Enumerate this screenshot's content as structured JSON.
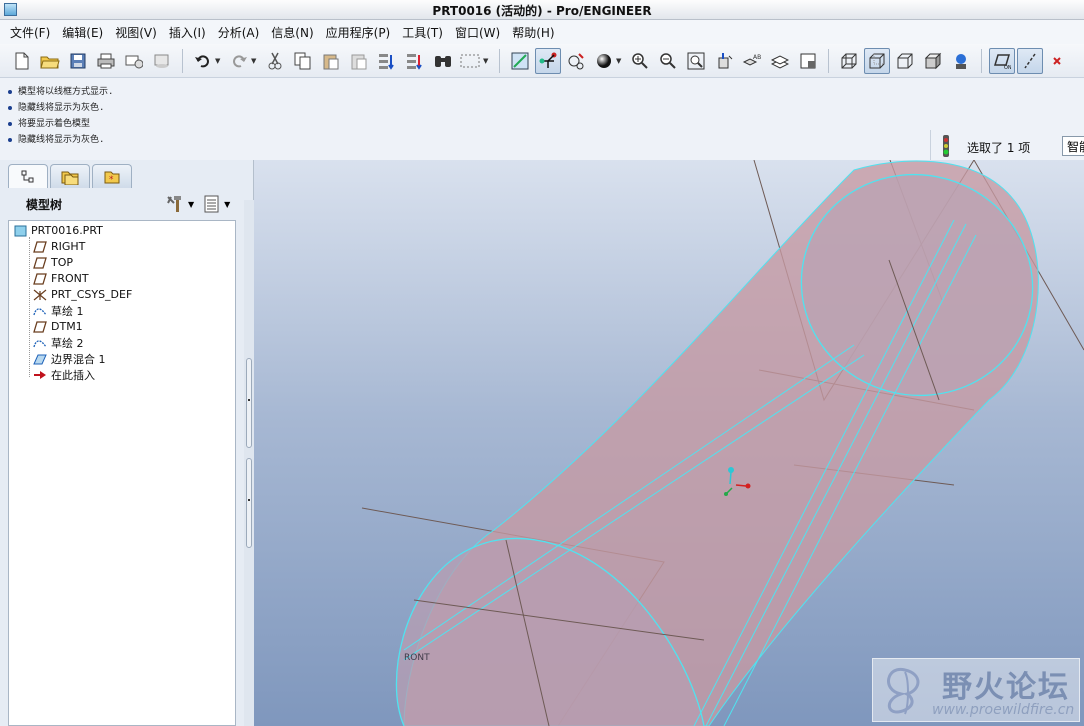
{
  "window": {
    "title": "PRT0016 (活动的) - Pro/ENGINEER"
  },
  "menu": [
    "文件(F)",
    "编辑(E)",
    "视图(V)",
    "插入(I)",
    "分析(A)",
    "信息(N)",
    "应用程序(P)",
    "工具(T)",
    "窗口(W)",
    "帮助(H)"
  ],
  "toolbar": {
    "groups": [
      [
        "new-file-icon",
        "open-folder-icon",
        "save-icon",
        "print-icon",
        "send-mail-icon",
        "close-window-icon"
      ],
      [
        "undo-icon",
        "redo-icon",
        "cut-icon",
        "copy-icon",
        "paste-icon",
        "paste-special-icon",
        "regenerate-icon",
        "regeneration-manager-icon",
        "find-icon",
        "selection-box-icon"
      ],
      [
        "repaint-icon",
        "spin-center-icon",
        "orient-mode-icon",
        "appearance-sphere-icon",
        "zoom-in-icon",
        "zoom-out-icon",
        "refit-icon",
        "reorient-icon",
        "saved-views-icon",
        "layers-icon",
        "view-manager-icon"
      ],
      [
        "wireframe-icon",
        "hidden-line-icon",
        "no-hidden-icon",
        "shading-icon",
        "enhanced-realism-icon"
      ],
      [
        "datum-plane-display-icon",
        "datum-axis-display-icon",
        "datum-point-display-icon"
      ]
    ],
    "active": [
      "spin-center-icon",
      "hidden-line-icon",
      "datum-plane-display-icon",
      "datum-axis-display-icon"
    ]
  },
  "messages": [
    "模型将以线框方式显示.",
    "隐藏线将显示为灰色.",
    "将要显示着色模型",
    "隐藏线将显示为灰色."
  ],
  "selection": {
    "text": "选取了 1 项",
    "filter_value": "智能"
  },
  "model_tree": {
    "title": "模型树",
    "tabs": [
      "model-tree-tab",
      "folder-browser-tab",
      "favorites-tab"
    ],
    "root": "PRT0016.PRT",
    "items": [
      {
        "label": "RIGHT",
        "icon": "datum-plane-icon"
      },
      {
        "label": "TOP",
        "icon": "datum-plane-icon"
      },
      {
        "label": "FRONT",
        "icon": "datum-plane-icon"
      },
      {
        "label": "PRT_CSYS_DEF",
        "icon": "coordinate-system-icon"
      },
      {
        "label": "草绘 1",
        "icon": "sketch-icon"
      },
      {
        "label": "DTM1",
        "icon": "datum-plane-icon"
      },
      {
        "label": "草绘 2",
        "icon": "sketch-icon"
      },
      {
        "label": "边界混合 1",
        "icon": "boundary-blend-icon"
      },
      {
        "label": "在此插入",
        "icon": "insert-here-arrow-icon"
      }
    ]
  },
  "graphics": {
    "datum_tag": "RONT",
    "colors": {
      "surface": "#c79aa3",
      "edge_highlight": "#4fe3f0",
      "datum_plane": "#6e5a55"
    }
  },
  "watermark": {
    "name": "野火论坛",
    "url": "www.proewildfire.cn"
  }
}
